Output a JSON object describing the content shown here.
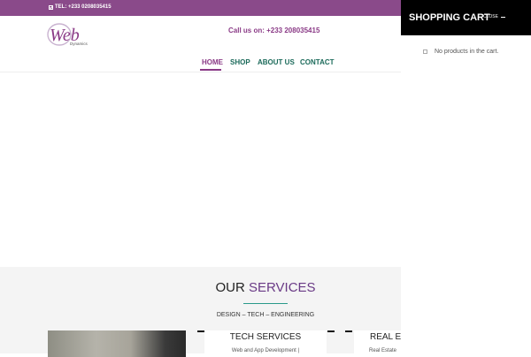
{
  "topbar": {
    "phone_label": "TEL: +233 0208035415"
  },
  "header": {
    "logo_text": "Web",
    "logo_subtext": "Dynamics",
    "call_text": "Call us on: +233 208035415"
  },
  "nav": {
    "items": [
      {
        "label": "HOME",
        "active": true
      },
      {
        "label": "SHOP"
      },
      {
        "label": "ABOUT US"
      },
      {
        "label": "CONTACT"
      }
    ]
  },
  "services": {
    "title_a": "OUR ",
    "title_b": "SERVICES",
    "subtitle": "DESIGN – TECH – ENGINEERING",
    "cards": [
      {
        "title": "TECH SERVICES",
        "text": "Web and App Development |"
      },
      {
        "title": "REAL ES",
        "text": "Real Estate"
      }
    ]
  },
  "cart": {
    "title": "SHOPPING CART",
    "close_label": "CLOSE",
    "empty_message": "No products in the cart."
  },
  "colors": {
    "brand_purple": "#8a4a8a",
    "nav_green": "#1b6a5a",
    "accent_teal": "#2a9a8a"
  }
}
